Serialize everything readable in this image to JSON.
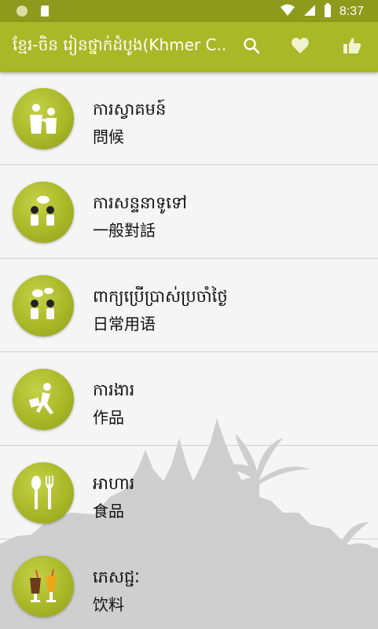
{
  "status_bar": {
    "time": "8:37",
    "icons": [
      "circle-notification-icon",
      "sd-card-icon",
      "wifi-icon",
      "signal-icon",
      "battery-icon"
    ]
  },
  "app_bar": {
    "title": "ខ្មែរ-ចិន រៀនថ្នាក់ដំបូង(Khmer C..",
    "actions": [
      "search-icon",
      "heart-icon",
      "thumbs-up-icon"
    ]
  },
  "categories": [
    {
      "km": "ការស្វាគមន៍",
      "zh": "問候",
      "icon": "greeting-people-icon"
    },
    {
      "km": "ការសន្ទនាទូទៅ",
      "zh": "一般對話",
      "icon": "conversation-icon"
    },
    {
      "km": "ពាក្យប្រើប្រាស់ប្រចាំថ្ងៃ",
      "zh": "日常用语",
      "icon": "daily-talk-icon"
    },
    {
      "km": "ការងារ",
      "zh": "作品",
      "icon": "work-runner-icon"
    },
    {
      "km": "អាហារ",
      "zh": "食品",
      "icon": "spoon-fork-icon"
    },
    {
      "km": "ភេសជ្ជៈ",
      "zh": "饮料",
      "icon": "drinks-icon"
    }
  ],
  "colors": {
    "status_bar": "#8d9a1c",
    "app_bar": "#a9b827",
    "icon_circle": "#a9b827",
    "background": "#f5f5f5"
  }
}
